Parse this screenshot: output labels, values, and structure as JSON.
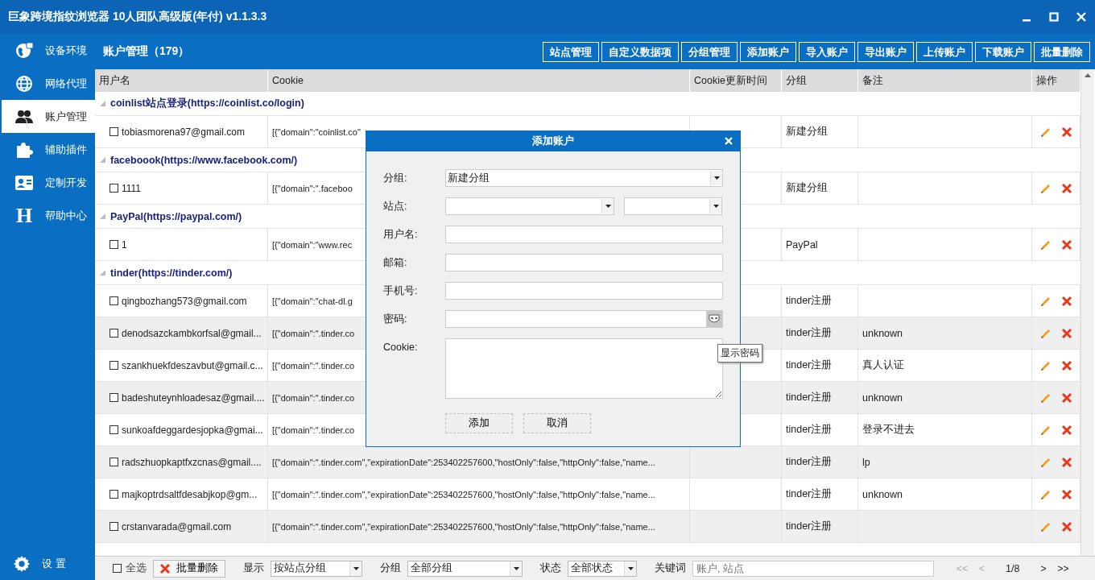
{
  "window": {
    "title": "巨象跨境指纹浏览器 10人团队高级版(年付) v1.1.3.3"
  },
  "sidebar": {
    "items": [
      {
        "label": "设备环境",
        "selected": false
      },
      {
        "label": "网络代理",
        "selected": false
      },
      {
        "label": "账户管理",
        "selected": true
      },
      {
        "label": "辅助插件",
        "selected": false
      },
      {
        "label": "定制开发",
        "selected": false
      },
      {
        "label": "帮助中心",
        "selected": false,
        "glyph": "H"
      }
    ],
    "settings": {
      "label": "设 置"
    }
  },
  "header": {
    "title": "账户管理（179）",
    "buttons": [
      "站点管理",
      "自定义数据项",
      "分组管理",
      "添加账户",
      "导入账户",
      "导出账户",
      "上传账户",
      "下载账户",
      "批量删除"
    ]
  },
  "table": {
    "columns": [
      "用户名",
      "Cookie",
      "Cookie更新时间",
      "分组",
      "备注",
      "操作"
    ],
    "groups": [
      {
        "title": "coinlist站点登录(https://coinlist.co/login)",
        "expanded": true,
        "rows": [
          {
            "username": "tobiasmorena97@gmail.com",
            "checked": false,
            "cookie": "[{\"domain\":\"coinlist.co\"",
            "group": "新建分组"
          }
        ]
      },
      {
        "title": "faceboook(https://www.facebook.com/)",
        "expanded": true,
        "rows": [
          {
            "username": "1111",
            "checked": false,
            "cookie": "[{\"domain\":\".faceboo",
            "group": "新建分组"
          }
        ]
      },
      {
        "title": "PayPal(https://paypal.com/)",
        "expanded": true,
        "rows": [
          {
            "username": "1",
            "checked": false,
            "cookie": "[{\"domain\":\"www.rec",
            "group": "PayPal"
          }
        ]
      },
      {
        "title": "tinder(https://tinder.com/)",
        "expanded": true,
        "rows": [
          {
            "username": "qingbozhang573@gmail.com",
            "checked": false,
            "cookie": "[{\"domain\":\"chat-dl.g",
            "group": "tinder注册"
          },
          {
            "username": "denodsazckambkorfsal@gmail...",
            "checked": false,
            "cookie": "[{\"domain\":\".tinder.co",
            "group": "tinder注册",
            "note": "unknown"
          },
          {
            "username": "szankhuekfdeszavbut@gmail.c...",
            "checked": false,
            "cookie": "[{\"domain\":\".tinder.co",
            "group": "tinder注册",
            "note": "真人认证"
          },
          {
            "username": "badeshuteynhloadesaz@gmail....",
            "checked": false,
            "cookie": "[{\"domain\":\".tinder.co",
            "group": "tinder注册",
            "note": "unknown"
          },
          {
            "username": "sunkoafdeggardesjopka@gmai...",
            "checked": false,
            "cookie": "[{\"domain\":\".tinder.co",
            "group": "tinder注册",
            "note": "登录不进去"
          },
          {
            "username": "radszhuopkaptfxzcnas@gmail....",
            "checked": false,
            "cookie": "[{\"domain\":\".tinder.com\",\"expirationDate\":253402257600,\"hostOnly\":false,\"httpOnly\":false,\"name...",
            "group": "tinder注册",
            "note": "lp"
          },
          {
            "username": "majkoptrdsaltfdesabjkop@gm...",
            "checked": false,
            "cookie": "[{\"domain\":\".tinder.com\",\"expirationDate\":253402257600,\"hostOnly\":false,\"httpOnly\":false,\"name...",
            "group": "tinder注册",
            "note": "unknown"
          },
          {
            "username": "crstanvarada@gmail.com",
            "checked": false,
            "cookie": "[{\"domain\":\".tinder.com\",\"expirationDate\":253402257600,\"hostOnly\":false,\"httpOnly\":false,\"name...",
            "group": "tinder注册"
          }
        ]
      }
    ]
  },
  "dialog": {
    "title": "添加账户",
    "fields": [
      {
        "label": "分组:",
        "kind": "select",
        "value": "新建分组"
      },
      {
        "label": "站点:",
        "kind": "select_pair"
      },
      {
        "label": "用户名:",
        "kind": "input"
      },
      {
        "label": "邮箱:",
        "kind": "input"
      },
      {
        "label": "手机号:",
        "kind": "input"
      },
      {
        "label": "密码:",
        "kind": "password"
      },
      {
        "label": "Cookie:",
        "kind": "textarea"
      }
    ],
    "buttons": [
      "添加",
      "取消"
    ],
    "tooltip": "显示密码"
  },
  "footer": {
    "select_all": {
      "label": "全选",
      "checked": false
    },
    "delete_button": "批量删除",
    "filters": [
      {
        "label": "显示",
        "value": "按站点分组",
        "kind": "wide"
      },
      {
        "label": "分组",
        "value": "全部分组",
        "kind": "wider"
      },
      {
        "label": "状态",
        "value": "全部状态",
        "kind": "narrow"
      }
    ],
    "keyword": {
      "label": "关键词",
      "placeholder": "账户, 站点"
    },
    "pager": [
      {
        "label": "<<",
        "disabled": true
      },
      {
        "label": "<",
        "disabled": true
      },
      {
        "label": "1/8",
        "kind": "page"
      },
      {
        "label": ">",
        "disabled": false
      },
      {
        "label": ">>",
        "disabled": false
      }
    ]
  }
}
